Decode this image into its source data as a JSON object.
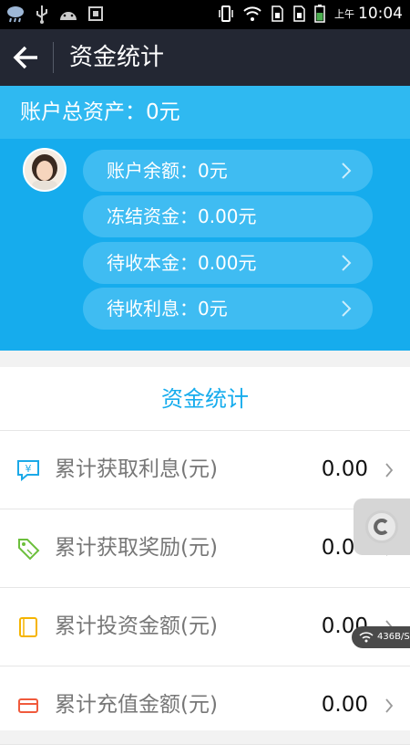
{
  "status_bar": {
    "ampm": "上午",
    "time": "10:04"
  },
  "header": {
    "title": "资金统计"
  },
  "summary": {
    "total_assets": "账户总资产：0元"
  },
  "pills": [
    {
      "text": "账户余额：0元",
      "has_arrow": true
    },
    {
      "text": "冻结资金：0.00元",
      "has_arrow": false
    },
    {
      "text": "待收本金：0.00元",
      "has_arrow": true
    },
    {
      "text": "待收利息：0元",
      "has_arrow": true
    }
  ],
  "section": {
    "title": "资金统计"
  },
  "rows": [
    {
      "label": "累计获取利息(元)",
      "value": "0.00",
      "icon": "yen-chat-icon",
      "icon_color": "#1ba9e8"
    },
    {
      "label": "累计获取奖励(元)",
      "value": "0.00",
      "icon": "price-tag-icon",
      "icon_color": "#6cbf3c"
    },
    {
      "label": "累计投资金额(元)",
      "value": "0.00",
      "icon": "wallet-icon",
      "icon_color": "#f5b400"
    },
    {
      "label": "累计充值金额(元)",
      "value": "0.00",
      "icon": "card-icon",
      "icon_color": "#f05a3c"
    }
  ],
  "overlay": {
    "net_speed": "436B/S"
  },
  "colors": {
    "header_bg": "#232733",
    "hero_bg": "#16aced",
    "accent": "#16aced"
  }
}
